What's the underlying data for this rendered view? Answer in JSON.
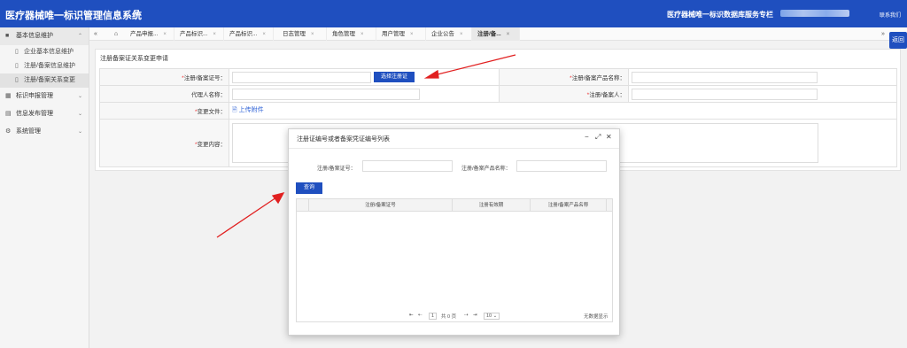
{
  "header": {
    "logo": "医疗器械唯一标识管理信息系统",
    "menu_toggle": "≡",
    "system_name": "医疗器械唯一标识数据库服务专栏",
    "contact": "联系我们"
  },
  "sidebar": {
    "groups": [
      {
        "label": "基本信息维护",
        "icon": "grid-icon",
        "chevron": "⌃"
      },
      {
        "label": "标识申报管理",
        "icon": "table-icon",
        "chevron": "⌄"
      },
      {
        "label": "信息发布管理",
        "icon": "image-icon",
        "chevron": "⌄"
      },
      {
        "label": "系统管理",
        "icon": "gear-icon",
        "chevron": "⌄"
      }
    ],
    "items": [
      {
        "label": "企业基本信息维护"
      },
      {
        "label": "注册/备案信息维护"
      },
      {
        "label": "注册/备案关系变更"
      }
    ]
  },
  "tabs": {
    "left_arrow": "«",
    "right_arrow": "»",
    "home_icon": "⌂",
    "items": [
      {
        "label": "产品申报..."
      },
      {
        "label": "产品标识..."
      },
      {
        "label": "产品标识..."
      },
      {
        "label": "日志管理"
      },
      {
        "label": "角色管理"
      },
      {
        "label": "用户管理"
      },
      {
        "label": "企业公告"
      },
      {
        "label": "注册/备..."
      }
    ],
    "close": "×",
    "back_label": "返回"
  },
  "form": {
    "title": "注册备案证关系变更申请",
    "reg_no_label": "注册/备案证号：",
    "pick_button": "选择注册证",
    "product_name_label": "注册/备案产品名称：",
    "agent_label": "代理人名称：",
    "registrant_label": "注册/备案人：",
    "file_label": "变更文件：",
    "upload_label": "上传附件",
    "content_label": "变更内容：",
    "required": "*"
  },
  "modal": {
    "title": "注册证编号或者备案凭证编号列表",
    "min_icon": "−",
    "max_icon": "⤢",
    "close_icon": "✕",
    "query_reg_label": "注册/备案证号：",
    "query_name_label": "注册/备案产品名称：",
    "query_button": "查询",
    "columns": [
      "注册/备案证号",
      "注册有效期",
      "注册/备案产品名称"
    ],
    "pager": {
      "first": "⇤",
      "prev": "⇠",
      "page": "1",
      "total_pages": "共 0 页",
      "next": "⇢",
      "last": "⇥",
      "page_size": "10 ⌄",
      "empty": "无数据显示"
    }
  }
}
